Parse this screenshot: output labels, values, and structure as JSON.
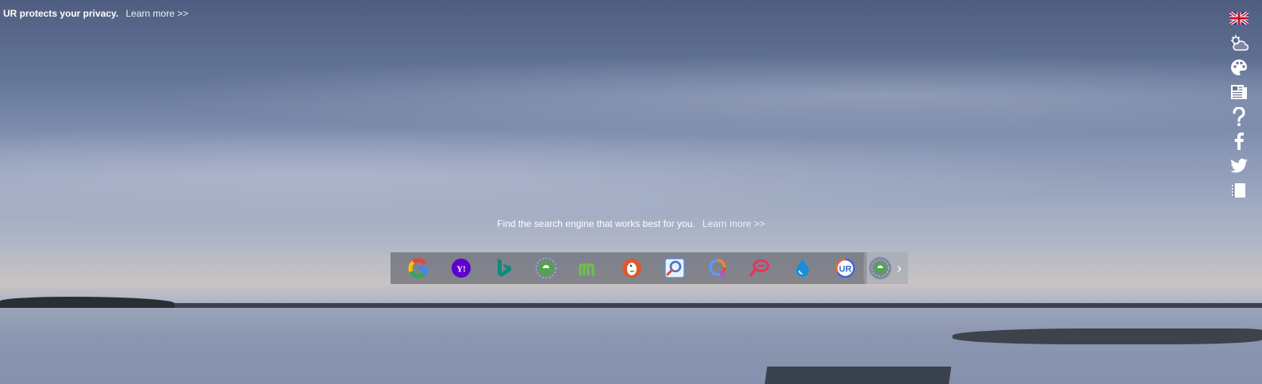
{
  "privacy": {
    "text": "UR protects your privacy.",
    "learn_more": "Learn more >>"
  },
  "tagline": {
    "text": "Find the search engine that works best for you.",
    "learn_more": "Learn more >>"
  },
  "side_icons": [
    "uk-flag-icon",
    "weather-icon",
    "palette-icon",
    "news-icon",
    "help-icon",
    "facebook-icon",
    "twitter-icon",
    "notes-icon"
  ],
  "engines": [
    {
      "name": "google-icon"
    },
    {
      "name": "yahoo-icon",
      "label": "Y!"
    },
    {
      "name": "bing-icon"
    },
    {
      "name": "ecosia-icon"
    },
    {
      "name": "moteur-icon"
    },
    {
      "name": "duckduckgo-icon"
    },
    {
      "name": "startpage-icon"
    },
    {
      "name": "qwant-icon"
    },
    {
      "name": "mojeek-icon"
    },
    {
      "name": "lilo-icon"
    },
    {
      "name": "ur-search-icon",
      "label": "UR"
    }
  ],
  "more_engines": {
    "label": "›"
  }
}
